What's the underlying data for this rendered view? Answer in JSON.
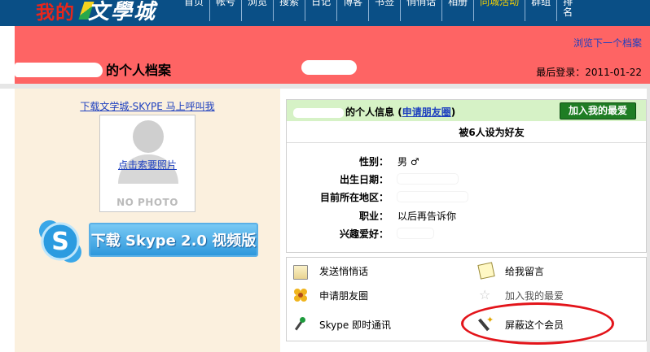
{
  "logo": {
    "part1": "我的",
    "part2": "文學城"
  },
  "nav": {
    "items": [
      "首页",
      "帐号",
      "浏览",
      "搜索",
      "日记",
      "博客",
      "书签",
      "悄悄话",
      "相册",
      "同城活动",
      "群组",
      "排名"
    ]
  },
  "header": {
    "browse_next": "浏览下一个档案",
    "profile_title": "的个人档案",
    "last_login_label": "最后登录：",
    "last_login_date": "2011-01-22"
  },
  "left": {
    "skype_download_link": "下载文学城-SKYPE 马上呼叫我",
    "photo_request_link": "点击索要照片",
    "no_photo_label": "NO PHOTO",
    "skype_banner": "下载 Skype 2.0 视频版"
  },
  "info": {
    "header_label": "的个人信息",
    "apply_friend_link": "申请朋友圈",
    "add_favorite_button": "加入我的最爱",
    "friends_text": "被6人设为好友",
    "fields": [
      {
        "label": "性别：",
        "value": "男 ♂"
      },
      {
        "label": "出生日期：",
        "value": ""
      },
      {
        "label": "目前所在地区：",
        "value": ""
      },
      {
        "label": "职业：",
        "value": "以后再告诉你"
      },
      {
        "label": "兴趣爱好：",
        "value": ""
      }
    ]
  },
  "actions": {
    "send_message": "发送悄悄话",
    "leave_comment": "给我留言",
    "apply_friend": "申请朋友圈",
    "add_favorite": "加入我的最爱",
    "skype_chat": "Skype 即时通讯",
    "block_member": "屏蔽这个会员"
  },
  "colors": {
    "nav_bg": "#0a4f86",
    "header_pink": "#fe6464",
    "left_bg": "#fbf0de",
    "green_header": "#d6f2c6",
    "button_green": "#1f7d24",
    "highlight_oval": "#e3141a"
  }
}
